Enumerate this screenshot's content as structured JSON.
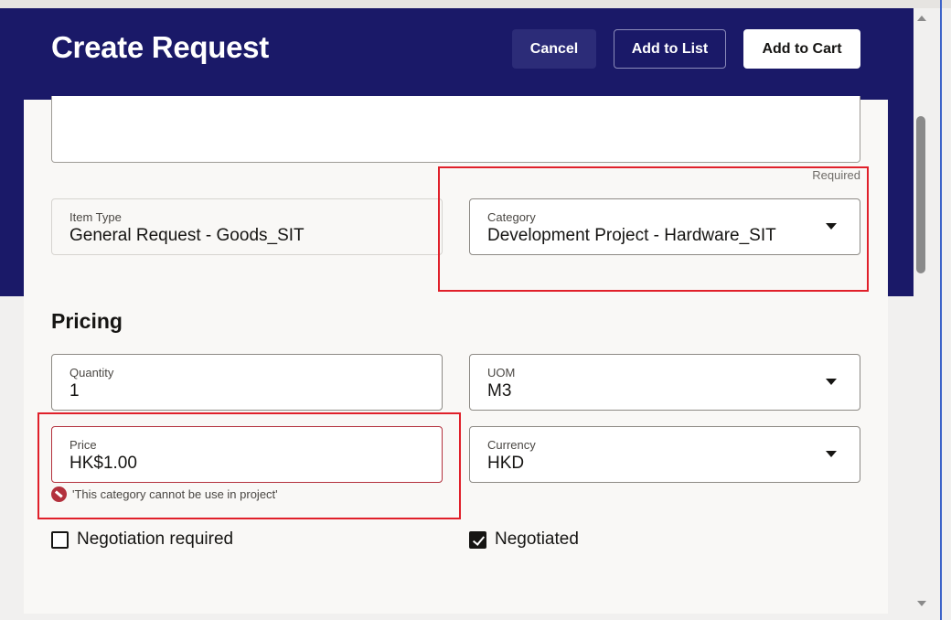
{
  "header": {
    "title": "Create Request",
    "cancel_label": "Cancel",
    "add_to_list_label": "Add to List",
    "add_to_cart_label": "Add to Cart"
  },
  "description": {
    "required_note": "Required"
  },
  "item_type": {
    "label": "Item Type",
    "value": "General Request - Goods_SIT"
  },
  "category": {
    "label": "Category",
    "value": "Development Project - Hardware_SIT"
  },
  "pricing": {
    "title": "Pricing",
    "quantity": {
      "label": "Quantity",
      "value": "1"
    },
    "uom": {
      "label": "UOM",
      "value": "M3"
    },
    "price": {
      "label": "Price",
      "value": "HK$1.00"
    },
    "currency": {
      "label": "Currency",
      "value": "HKD"
    },
    "price_error": "'This category cannot be use in project'",
    "negotiation_required": {
      "label": "Negotiation required",
      "checked": false
    },
    "negotiated": {
      "label": "Negotiated",
      "checked": true
    }
  },
  "colors": {
    "header_bg": "#1a1968",
    "error": "#b3313d",
    "highlight": "#e0202a"
  }
}
